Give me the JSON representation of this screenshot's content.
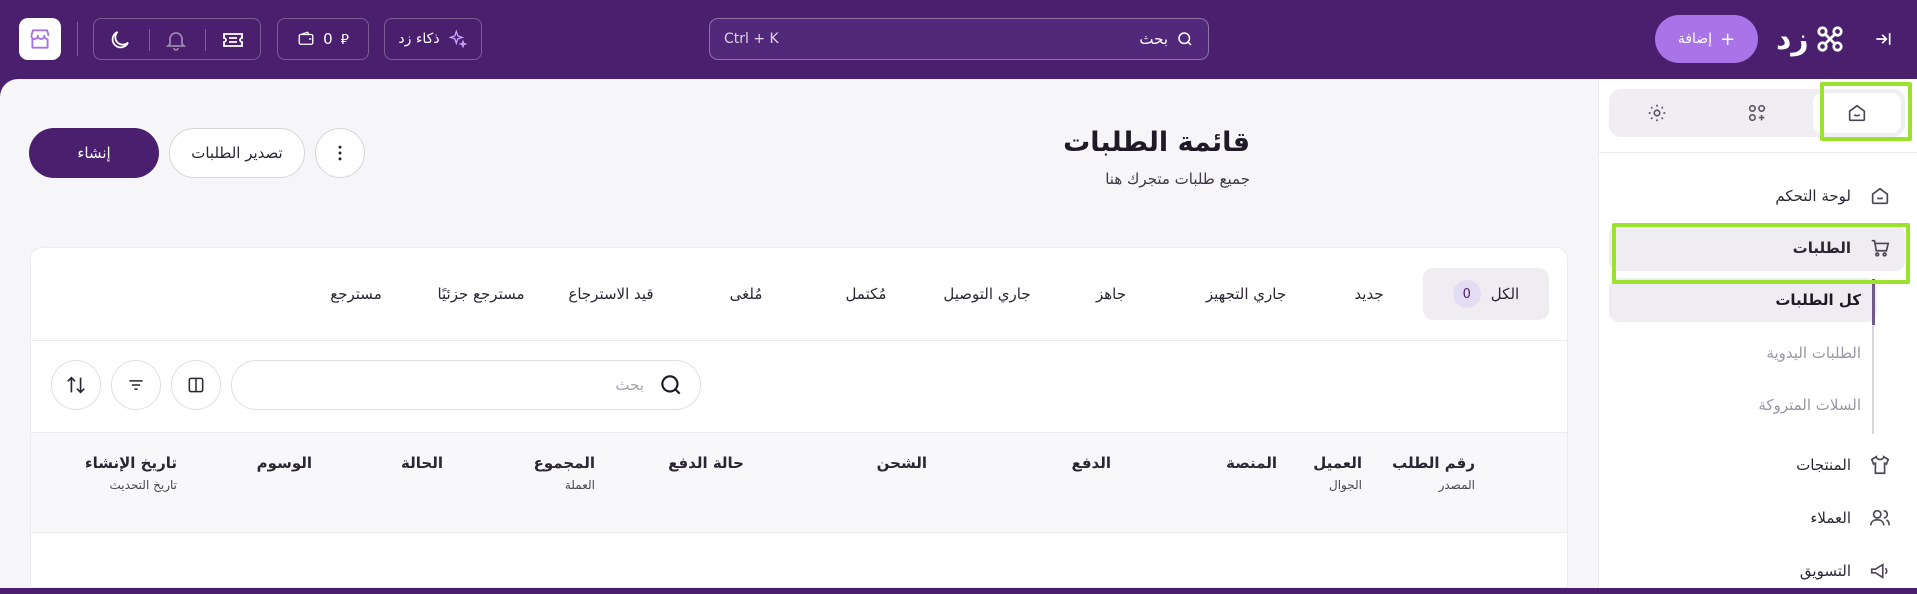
{
  "topbar": {
    "search_label": "بحث",
    "search_hint": "Ctrl + K",
    "ai_label": "ذكاء زد",
    "wallet_value": "0",
    "add_label": "إضافة",
    "logo_text": "زد"
  },
  "sidebar": {
    "items": [
      {
        "label": "لوحة التحكم"
      },
      {
        "label": "الطلبات"
      },
      {
        "label": "المنتجات"
      },
      {
        "label": "العملاء"
      },
      {
        "label": "التسويق"
      }
    ],
    "subitems": [
      {
        "label": "كل الطلبات"
      },
      {
        "label": "الطلبات اليدوية"
      },
      {
        "label": "السلات المتروكة"
      }
    ]
  },
  "page": {
    "title": "قائمة الطلبات",
    "subtitle": "جميع طلبات متجرك هنا",
    "create_label": "إنشاء",
    "export_label": "تصدير الطلبات"
  },
  "status_tabs": {
    "all": {
      "label": "الكل",
      "count": "0"
    },
    "new": "جديد",
    "preparing": "جاري التجهيز",
    "ready": "جاهز",
    "delivering": "جاري التوصيل",
    "completed": "مُكتمل",
    "cancelled": "مُلغى",
    "returning": "قيد الاسترجاع",
    "partial_returned": "مسترجع جزئيًا",
    "returned": "مسترجع"
  },
  "table": {
    "search_placeholder": "بحث",
    "columns": [
      {
        "label": "رقم الطلب",
        "sub": "المصدر"
      },
      {
        "label": "العميل",
        "sub": "الجوال"
      },
      {
        "label": "المنصة",
        "sub": ""
      },
      {
        "label": "الدفع",
        "sub": ""
      },
      {
        "label": "الشحن",
        "sub": ""
      },
      {
        "label": "حالة الدفع",
        "sub": ""
      },
      {
        "label": "المجموع",
        "sub": "العملة"
      },
      {
        "label": "الحالة",
        "sub": ""
      },
      {
        "label": "الوسوم",
        "sub": ""
      },
      {
        "label": "تاريخ الإنشاء",
        "sub": "تاريخ التحديث"
      }
    ]
  },
  "colors": {
    "brand": "#4a1f6e",
    "accent": "#a874e8",
    "highlight": "#9be22e"
  }
}
